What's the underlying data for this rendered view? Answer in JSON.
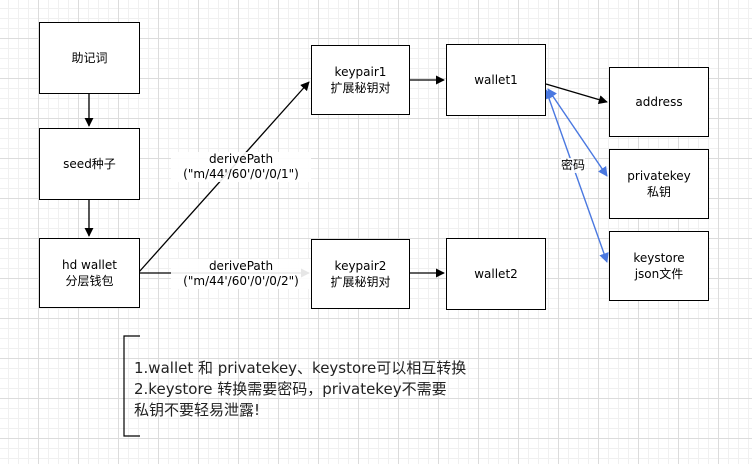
{
  "nodes": {
    "mnemonic": "助记词",
    "seed_line1": "seed种子",
    "hd_line1": "hd wallet",
    "hd_line2": "分层钱包",
    "keypair1_line1": "keypair1",
    "keypair1_line2": "扩展秘钥对",
    "keypair2_line1": "keypair2",
    "keypair2_line2": "扩展秘钥对",
    "wallet1": "wallet1",
    "wallet2": "wallet2",
    "address": "address",
    "privatekey_line1": "privatekey",
    "privatekey_line2": "私钥",
    "keystore_line1": "keystore",
    "keystore_line2": "json文件"
  },
  "edges": {
    "path1_line1": "derivePath",
    "path1_line2": "(\"m/44'/60'/0'/0/1\")",
    "path2_line1": "derivePath",
    "path2_line2": "(\"m/44'/60'/0'/0/2\")",
    "password": "密码"
  },
  "note": {
    "line1": "1.wallet 和 privatekey、keystore可以相互转换",
    "line2": "2.keystore 转换需要密码，privatekey不需要",
    "line3": "私钥不要轻易泄露!"
  },
  "colors": {
    "line": "#000000",
    "blue_arrow": "#4a78e0"
  }
}
